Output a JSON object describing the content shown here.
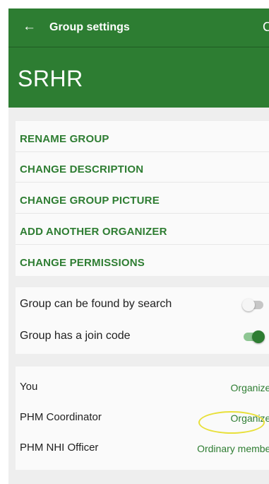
{
  "toolbar": {
    "back_icon": "←",
    "title": "Group settings",
    "refresh_icon": "C"
  },
  "group": {
    "name": "SRHR"
  },
  "actions": [
    {
      "label": "RENAME GROUP"
    },
    {
      "label": "CHANGE DESCRIPTION"
    },
    {
      "label": "CHANGE GROUP PICTURE"
    },
    {
      "label": "ADD ANOTHER ORGANIZER"
    },
    {
      "label": "CHANGE PERMISSIONS"
    }
  ],
  "toggles": [
    {
      "label": "Group can be found by search",
      "state": "off"
    },
    {
      "label": "Group has a join code",
      "state": "on"
    }
  ],
  "members": [
    {
      "name": "You",
      "role": "Organizer"
    },
    {
      "name": "PHM Coordinator",
      "role": "Organizer"
    },
    {
      "name": "PHM NHI Officer",
      "role": "Ordinary member"
    }
  ],
  "colors": {
    "primary": "#2d7d32",
    "accent_text": "#2e7d32",
    "highlight_circle": "#e8e03a"
  }
}
